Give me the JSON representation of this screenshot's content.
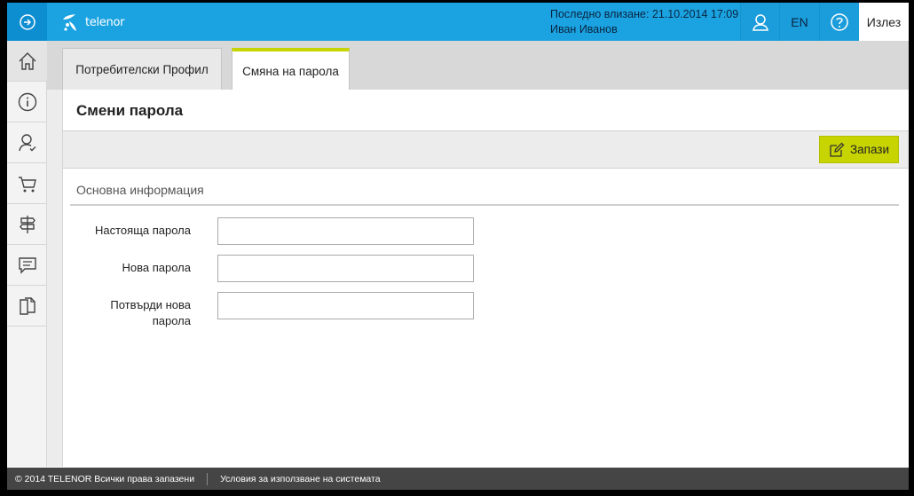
{
  "header": {
    "logo_text": "telenor",
    "last_login_label": "Последно влизане: 21.10.2014 17:09",
    "user_name": "Иван Иванов",
    "lang_label": "EN",
    "logout_label": "Излез"
  },
  "sidebar": {
    "items": [
      {
        "icon": "home-icon"
      },
      {
        "icon": "info-icon"
      },
      {
        "icon": "user-icon"
      },
      {
        "icon": "cart-icon"
      },
      {
        "icon": "signpost-icon"
      },
      {
        "icon": "message-icon"
      },
      {
        "icon": "documents-icon"
      }
    ]
  },
  "tabs": {
    "profile_label": "Потребителски Профил",
    "password_label": "Смяна на парола"
  },
  "main": {
    "title": "Смени парола",
    "save_label": "Запази",
    "section_title": "Основна информация",
    "fields": {
      "current_password_label": "Настояща парола",
      "new_password_label": "Нова парола",
      "confirm_password_label": "Потвърди нова парола",
      "current_password_value": "",
      "new_password_value": "",
      "confirm_password_value": ""
    }
  },
  "footer": {
    "copyright": "© 2014 TELENOR Всички права запазени",
    "terms_link": "Условия за използване на системата"
  },
  "colors": {
    "header_blue": "#1ba3e1",
    "accent_green": "#c8d400",
    "footer_gray": "#454545"
  }
}
